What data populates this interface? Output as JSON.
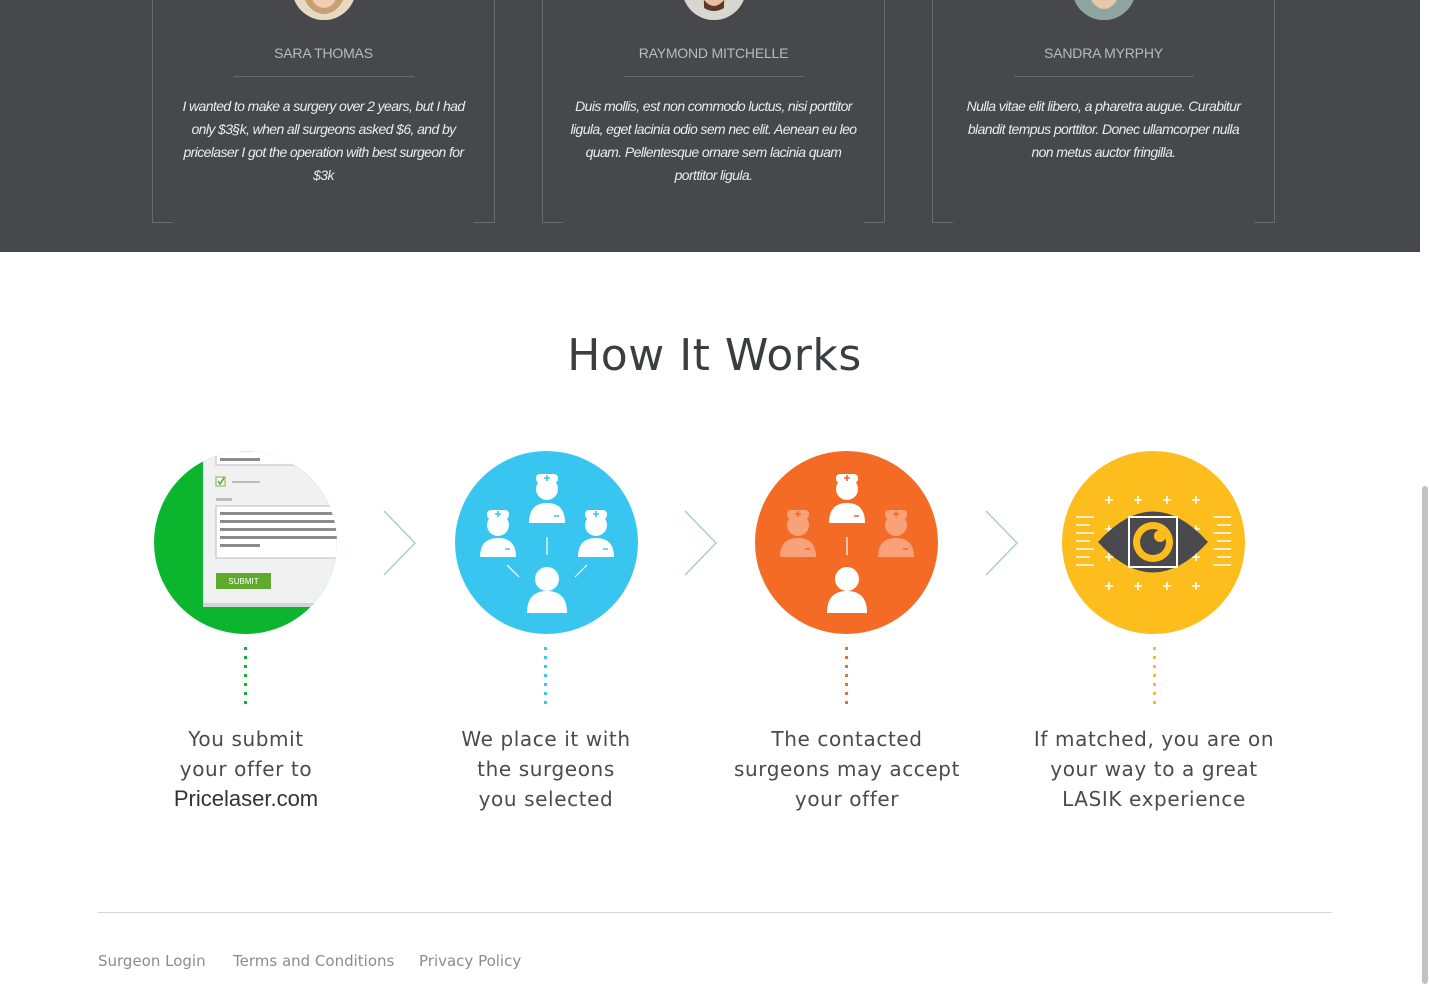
{
  "testimonials": [
    {
      "name": "SARA THOMAS",
      "quote": "I wanted to make a surgery over 2 years, but I had only $3§k, when all surgeons asked $6, and by pricelaser I got the operation with best surgeon for $3k"
    },
    {
      "name": "RAYMOND MITCHELLE",
      "quote": "Duis mollis, est non commodo luctus, nisi porttitor ligula, eget lacinia odio sem nec elit. Aenean eu leo quam. Pellentesque ornare sem lacinia quam porttitor ligula."
    },
    {
      "name": "SANDRA MYRPHY",
      "quote": "Nulla vitae elit libero, a pharetra augue. Curabitur blandit tempus porttitor. Donec ullamcorper nulla non metus auctor fringilla."
    }
  ],
  "how_it_works": {
    "title": "How It Works",
    "submit_label": "SUBMIT",
    "steps": [
      {
        "line1": "You submit",
        "line2": "your offer to",
        "line3": "Pricelaser.com",
        "color": "#0bb52d",
        "icon": "form-icon"
      },
      {
        "line1": "We place it with",
        "line2": "the surgeons",
        "line3": "you selected",
        "color": "#38c6f0",
        "icon": "surgeons-network-icon"
      },
      {
        "line1": "The contacted",
        "line2": "surgeons may accept",
        "line3": "your offer",
        "color": "#f46b25",
        "icon": "surgeon-accept-icon"
      },
      {
        "line1": "If matched, you are on",
        "line2": "your way to a great",
        "line3": "LASIK experience",
        "color": "#fdbd1c",
        "icon": "eye-icon"
      }
    ]
  },
  "footer": {
    "links": [
      "Surgeon Login",
      "Terms and Conditions",
      "Privacy Policy"
    ]
  }
}
